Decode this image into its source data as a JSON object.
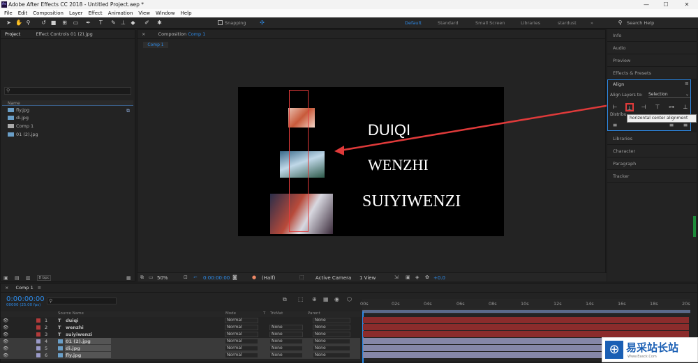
{
  "window": {
    "title": "Adobe After Effects CC 2018 - Untitled Project.aep *",
    "app_icon": "Ae",
    "controls": [
      "—",
      "☐",
      "✕"
    ]
  },
  "menu": [
    "File",
    "Edit",
    "Composition",
    "Layer",
    "Effect",
    "Animation",
    "View",
    "Window",
    "Help"
  ],
  "toolbar": {
    "snapping": "Snapping",
    "workspaces": [
      "Default",
      "Standard",
      "Small Screen",
      "Libraries",
      "stardust"
    ],
    "search_placeholder": "Search Help"
  },
  "project": {
    "tab": "Project",
    "effects_tab": "Effect Controls 01 (2).jpg",
    "search_placeholder": "",
    "name_header": "Name",
    "items": [
      "fly.jpg",
      "di.jpg",
      "Comp 1",
      "01 (2).jpg"
    ],
    "bpc": "8 bpc"
  },
  "composition": {
    "tab": "Composition",
    "comp_name": "Comp 1",
    "breadcrumb": "Comp 1",
    "texts": [
      "DUIQI",
      "WENZHI",
      "SUIYIWENZI"
    ],
    "zoom": "50%",
    "time": "0:00:00:00",
    "resolution": "(Half)",
    "camera": "Active Camera",
    "view": "1 View",
    "exposure": "+0.0"
  },
  "right_panels": {
    "top": [
      "Info",
      "Audio",
      "Preview",
      "Effects & Presets"
    ],
    "align": {
      "title": "Align",
      "align_to_label": "Align Layers to:",
      "align_to_value": "Selection",
      "distribute_label": "Distribu",
      "tooltip": "horizontal center alignment"
    },
    "bottom": [
      "Libraries",
      "Character",
      "Paragraph",
      "Tracker"
    ]
  },
  "timeline": {
    "tab": "Comp 1",
    "timecode": "0:00:00:00",
    "fps": "00000 (25.00 fps)",
    "search_placeholder": "",
    "headers": {
      "source": "Source Name",
      "mode": "Mode",
      "t": "T",
      "trkmat": "TrkMat",
      "parent": "Parent"
    },
    "layers": [
      {
        "num": "1",
        "type": "T",
        "name": "duiqi",
        "mode": "Normal",
        "trkmat": "",
        "parent": "None",
        "color": "#b23a3a"
      },
      {
        "num": "2",
        "type": "T",
        "name": "wenzhi",
        "mode": "Normal",
        "trkmat": "None",
        "parent": "None",
        "color": "#b23a3a"
      },
      {
        "num": "3",
        "type": "T",
        "name": "suiyiwenzi",
        "mode": "Normal",
        "trkmat": "None",
        "parent": "None",
        "color": "#b23a3a"
      },
      {
        "num": "4",
        "type": "img",
        "name": "01 (2).jpg",
        "mode": "Normal",
        "trkmat": "None",
        "parent": "None",
        "color": "#9a9ac8"
      },
      {
        "num": "5",
        "type": "img",
        "name": "di.jpg",
        "mode": "Normal",
        "trkmat": "None",
        "parent": "None",
        "color": "#9a9ac8"
      },
      {
        "num": "6",
        "type": "img",
        "name": "fly.jpg",
        "mode": "Normal",
        "trkmat": "None",
        "parent": "None",
        "color": "#9a9ac8"
      }
    ],
    "ruler": [
      "00s",
      "02s",
      "04s",
      "06s",
      "08s",
      "10s",
      "12s",
      "14s",
      "16s",
      "18s",
      "20s"
    ]
  },
  "watermark": {
    "text": "易采站长站",
    "sub": "Www.Easck.Com"
  },
  "colors": {
    "accent": "#2d8ceb",
    "annotation": "#e03a3a",
    "text_bar": "#8b2c2c",
    "image_bar": "#8587a8"
  }
}
